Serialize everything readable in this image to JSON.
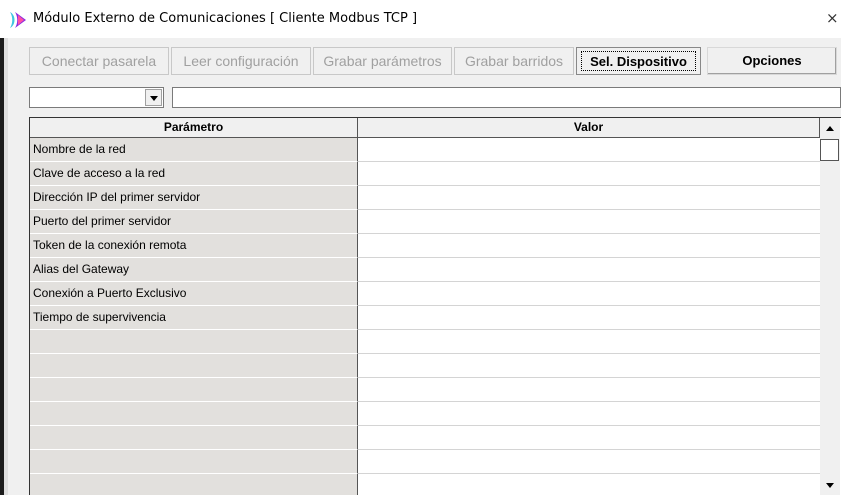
{
  "window": {
    "title": "Módulo Externo de Comunicaciones  [ Cliente Modbus TCP ]",
    "close_glyph": "×",
    "app_icon": "app-logo-icon",
    "icon_colors": {
      "left": "#3ec6e0",
      "right": "#8a2be2"
    }
  },
  "toolbar": {
    "buttons": [
      {
        "label": "Conectar pasarela",
        "enabled": false
      },
      {
        "label": "Leer configuración",
        "enabled": false
      },
      {
        "label": "Grabar parámetros",
        "enabled": false
      },
      {
        "label": "Grabar barridos",
        "enabled": false
      },
      {
        "label": "Sel. Dispositivo",
        "enabled": true,
        "focused": true
      },
      {
        "label": "Opciones",
        "enabled": true
      }
    ]
  },
  "filter": {
    "combo_value": "",
    "text_value": ""
  },
  "grid": {
    "columns": [
      "Parámetro",
      "Valor"
    ],
    "rows": [
      {
        "param": "Nombre de la red",
        "value": ""
      },
      {
        "param": "Clave de acceso a la red",
        "value": ""
      },
      {
        "param": "Dirección IP del primer servidor",
        "value": ""
      },
      {
        "param": "Puerto del primer servidor",
        "value": ""
      },
      {
        "param": "Token de la conexión remota",
        "value": ""
      },
      {
        "param": "Alias del Gateway",
        "value": ""
      },
      {
        "param": "Conexión a Puerto Exclusivo",
        "value": ""
      },
      {
        "param": "Tiempo de supervivencia",
        "value": ""
      },
      {
        "param": "",
        "value": ""
      },
      {
        "param": "",
        "value": ""
      },
      {
        "param": "",
        "value": ""
      },
      {
        "param": "",
        "value": ""
      },
      {
        "param": "",
        "value": ""
      },
      {
        "param": "",
        "value": ""
      },
      {
        "param": "",
        "value": ""
      }
    ],
    "param_column_color": "#e2e0dd"
  }
}
